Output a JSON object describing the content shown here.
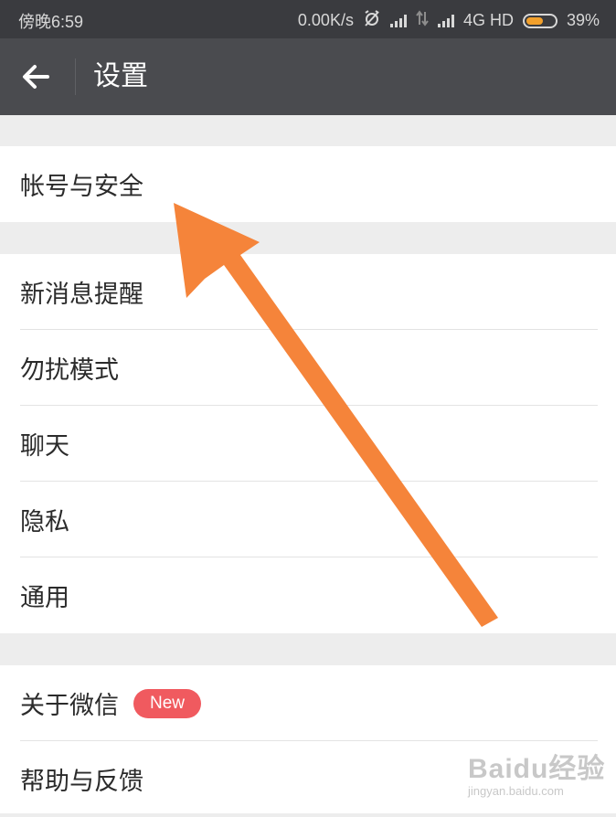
{
  "status_bar": {
    "time": "傍晚6:59",
    "speed": "0.00K/s",
    "network": "4G HD",
    "battery": "39%",
    "icons": [
      "alarm-off-icon",
      "signal-icon",
      "data-arrows-icon",
      "signal-icon",
      "battery-icon"
    ]
  },
  "header": {
    "title": "设置",
    "back_icon": "back-arrow-icon"
  },
  "sections": [
    {
      "items": [
        {
          "label": "帐号与安全"
        }
      ]
    },
    {
      "items": [
        {
          "label": "新消息提醒"
        },
        {
          "label": "勿扰模式"
        },
        {
          "label": "聊天"
        },
        {
          "label": "隐私"
        },
        {
          "label": "通用"
        }
      ]
    },
    {
      "items": [
        {
          "label": "关于微信",
          "badge": "New"
        },
        {
          "label": "帮助与反馈"
        }
      ]
    }
  ],
  "watermark": {
    "logo": "Baidu经验",
    "url": "jingyan.baidu.com"
  },
  "colors": {
    "status_bar_bg": "#3a3b3f",
    "app_bar_bg": "#4a4b4f",
    "page_bg": "#ededed",
    "badge_bg": "#f05a5f",
    "annotation_arrow": "#f5843a"
  }
}
